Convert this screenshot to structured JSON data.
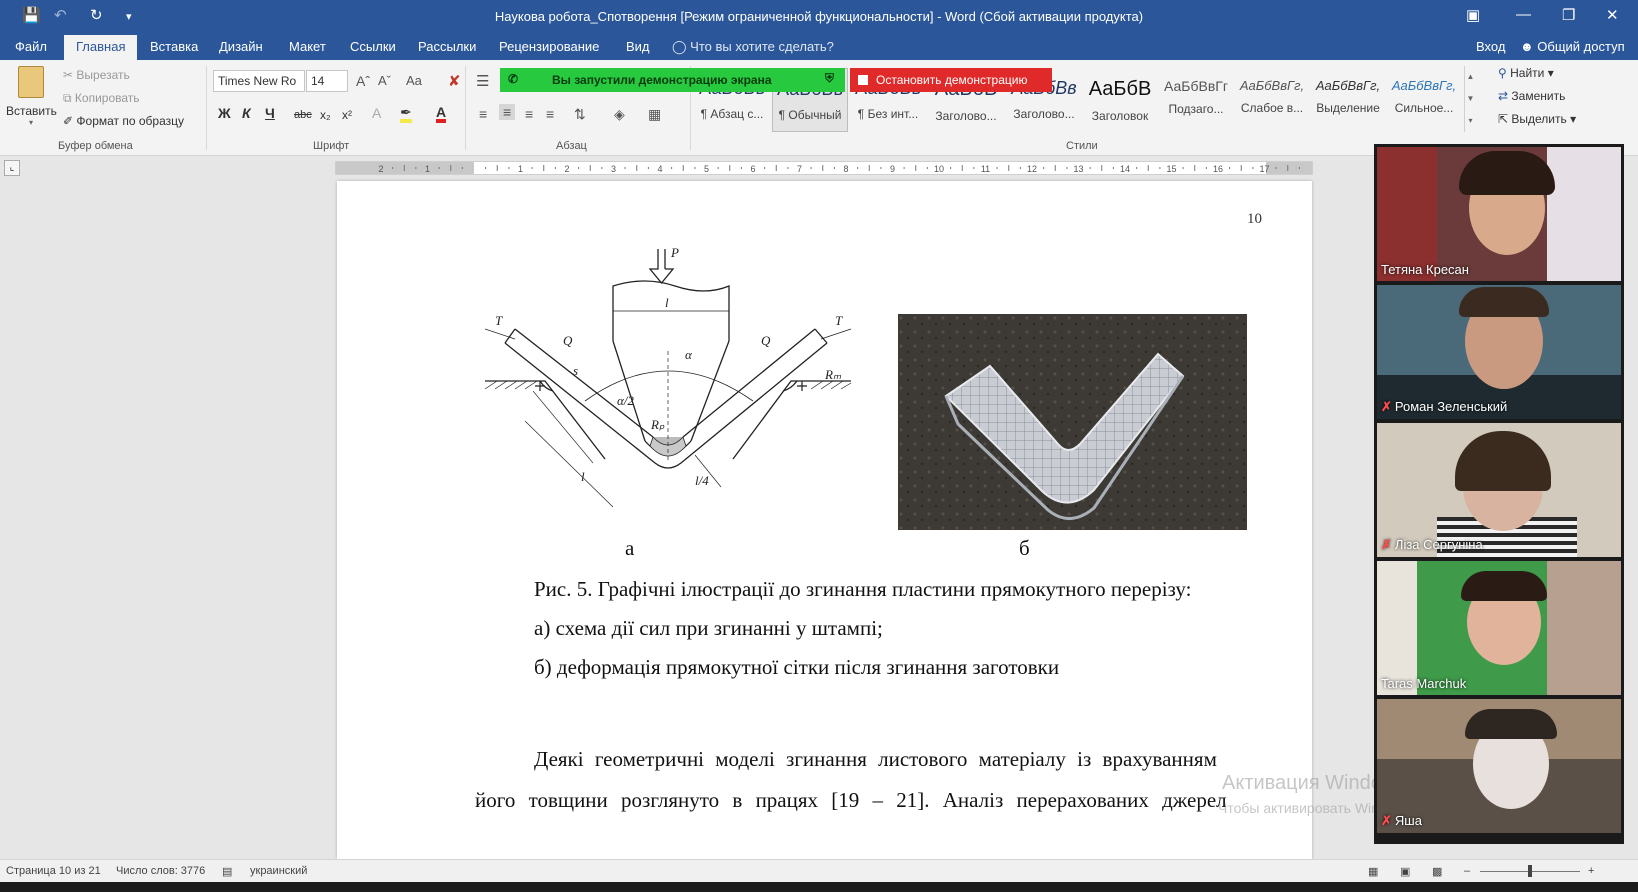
{
  "titlebar": {
    "title": "Наукова робота_Спотворення [Режим ограниченной функциональности] - Word (Сбой активации продукта)",
    "save_icon": "save-icon",
    "undo_icon": "undo-icon",
    "redo_icon": "redo-icon"
  },
  "tabs": [
    {
      "label": "Файл"
    },
    {
      "label": "Главная",
      "active": true
    },
    {
      "label": "Вставка"
    },
    {
      "label": "Дизайн"
    },
    {
      "label": "Макет"
    },
    {
      "label": "Ссылки"
    },
    {
      "label": "Рассылки"
    },
    {
      "label": "Рецензирование"
    },
    {
      "label": "Вид"
    }
  ],
  "tell_me": "Что вы хотите сделать?",
  "signin": "Вход",
  "share": "Общий доступ",
  "clipboard": {
    "paste": "Вставить",
    "cut": "Вырезать",
    "copy": "Копировать",
    "format_painter": "Формат по образцу",
    "label": "Буфер обмена"
  },
  "font": {
    "name": "Times New Ro",
    "size": "14",
    "label": "Шрифт",
    "case": "Aa",
    "bold": "Ж",
    "italic": "К",
    "underline": "Ч",
    "strike": "abc",
    "sub": "x₂",
    "sup": "x²"
  },
  "paragraph": {
    "label": "Абзац"
  },
  "styles": {
    "label": "Стили",
    "items": [
      {
        "sample": "АаБбВв",
        "name": "¶ Абзац с..."
      },
      {
        "sample": "АаБбВв",
        "name": "¶ Обычный"
      },
      {
        "sample": "АаБбВв",
        "name": "¶ Без инт..."
      },
      {
        "sample": "АаБбВ",
        "name": "Заголово..."
      },
      {
        "sample": "АаБбВв",
        "name": "Заголово..."
      },
      {
        "sample": "АаБбВ",
        "name": "Заголовок"
      },
      {
        "sample": "АаБбВвГг",
        "name": "Подзаго..."
      },
      {
        "sample": "АаБбВвГг,",
        "name": "Слабое в..."
      },
      {
        "sample": "АаБбВвГг,",
        "name": "Выделение"
      },
      {
        "sample": "АаБбВвГг,",
        "name": "Сильное..."
      }
    ]
  },
  "editing": {
    "find": "Найти",
    "replace": "Заменить",
    "select": "Выделить"
  },
  "screenshare": {
    "started": "Вы запустили демонстрацию экрана",
    "stop": "Остановить демонстрацию"
  },
  "document": {
    "page_number": "10",
    "label_a": "а",
    "label_b": "б",
    "caption_line1": "Рис. 5. Графічні ілюстрації до згинання пластини прямокутного перерізу:",
    "caption_line2": "а) схема дії сил при згинанні у штампі;",
    "caption_line3": "б) деформація прямокутної сітки після згинання заготовки",
    "body_line1": "Деякі геометричні моделі згинання листового матеріалу із врахуванням",
    "body_line2": "його товщини розглянуто в працях [19 – 21]. Аналіз перерахованих джерел",
    "diagram_labels": {
      "P": "P",
      "T_left": "T",
      "T_right": "T",
      "Q_left": "Q",
      "Q_right": "Q",
      "l": "l",
      "s": "s",
      "alpha": "α",
      "alpha_half": "α/2",
      "Rp": "Rₚ",
      "Rm": "Rₘ",
      "l_left": "l",
      "l4": "l/4"
    }
  },
  "activation": {
    "line1": "Активация Windows",
    "line2": "Чтобы активировать Windows, перейдите в раздел"
  },
  "participants": [
    {
      "name": "Тетяна Кресан",
      "muted": false,
      "bg": "#6b3a3a"
    },
    {
      "name": "Роман Зеленський",
      "muted": true,
      "bg": "#4a6a7a"
    },
    {
      "name": "Ліза Сергуніна",
      "muted": true,
      "bg": "#c8c0b0"
    },
    {
      "name": "Taras Marchuk",
      "muted": false,
      "bg": "#2f8a3a"
    },
    {
      "name": "Яша",
      "muted": true,
      "bg": "#5a5048"
    }
  ],
  "status": {
    "page": "Страница 10 из 21",
    "words": "Число слов: 3776",
    "language": "украинский"
  }
}
